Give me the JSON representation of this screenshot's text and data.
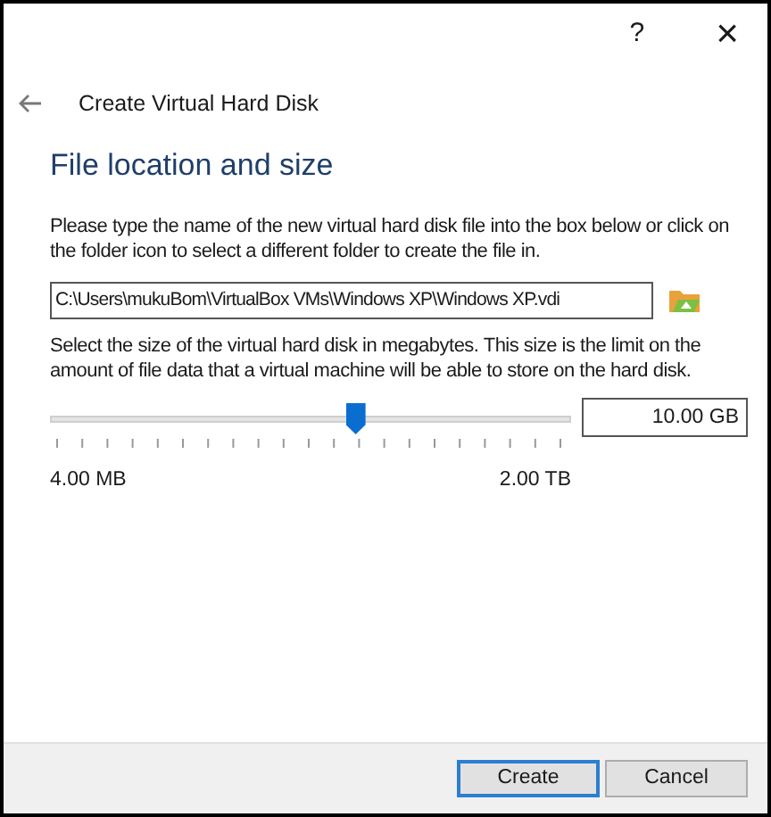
{
  "title_bar": {
    "help": "?",
    "close": "×"
  },
  "header": {
    "title": "Create Virtual Hard Disk"
  },
  "section": {
    "heading": "File location and size",
    "location_text": "Please type the name of the new virtual hard disk file into the box below or click on the folder icon to select a different folder to create the file in.",
    "path": "C:\\Users\\mukuBom\\VirtualBox VMs\\Windows XP\\Windows XP.vdi",
    "size_text": "Select the size of the virtual hard disk in megabytes. This size is the limit on the amount of file data that a virtual machine will be able to store on the hard disk.",
    "size_slider": {
      "level": 0.585,
      "min_label": "4.00 MB",
      "max_label": "2.00 TB"
    },
    "size_value": "10.00 GB"
  },
  "buttons": [
    {
      "label": "Create",
      "default": true
    },
    {
      "label": "Cancel",
      "default": false
    }
  ]
}
